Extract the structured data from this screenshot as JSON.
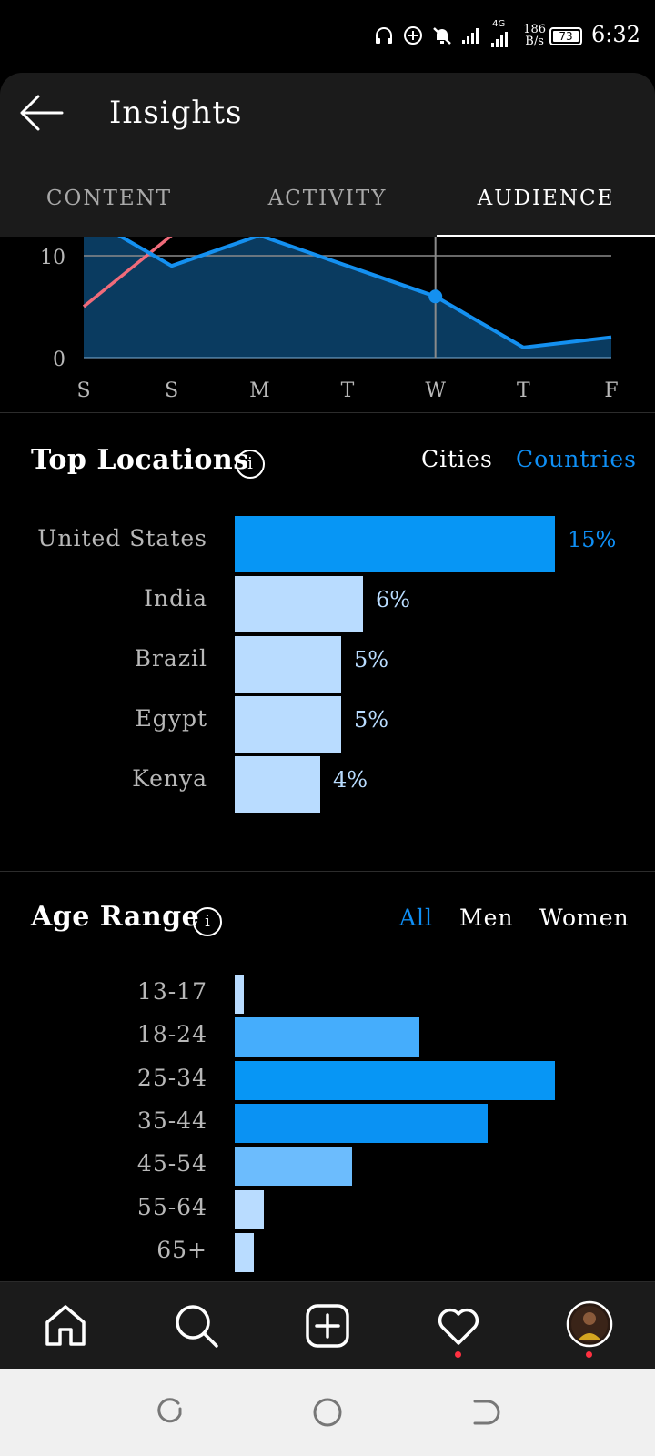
{
  "status_bar": {
    "speed_value": "186",
    "speed_unit": "B/s",
    "network": "4G",
    "battery": "73",
    "time": "6:32"
  },
  "header": {
    "title": "Insights",
    "tabs": [
      {
        "label": "CONTENT",
        "active": false
      },
      {
        "label": "ACTIVITY",
        "active": false
      },
      {
        "label": "AUDIENCE",
        "active": true
      }
    ]
  },
  "chart_data": {
    "type": "line",
    "x": [
      "S",
      "S",
      "M",
      "T",
      "W",
      "T",
      "F"
    ],
    "ylim": [
      0,
      12
    ],
    "yticks": [
      "0",
      "10"
    ],
    "grid": true,
    "series": [
      {
        "values": [
          14,
          9,
          12,
          9,
          6,
          1,
          2
        ],
        "color": "#1490f0",
        "fill": "#0a3b60"
      },
      {
        "values": [
          5,
          12
        ],
        "color": "#f06b7a"
      }
    ],
    "highlight_index": 4
  },
  "top_locations": {
    "title": "Top Locations",
    "filters": [
      {
        "label": "Cities",
        "active": false
      },
      {
        "label": "Countries",
        "active": true
      }
    ],
    "rows": [
      {
        "label": "United States",
        "value": 15,
        "display": "15%",
        "highlight": true
      },
      {
        "label": "India",
        "value": 6,
        "display": "6%",
        "highlight": false
      },
      {
        "label": "Brazil",
        "value": 5,
        "display": "5%",
        "highlight": false
      },
      {
        "label": "Egypt",
        "value": 5,
        "display": "5%",
        "highlight": false
      },
      {
        "label": "Kenya",
        "value": 4,
        "display": "4%",
        "highlight": false
      }
    ]
  },
  "age_range": {
    "title": "Age Range",
    "filters": [
      {
        "label": "All",
        "active": true
      },
      {
        "label": "Men",
        "active": false
      },
      {
        "label": "Women",
        "active": false
      }
    ],
    "rows": [
      {
        "label": "13-17",
        "value": 1.5,
        "color": "#b9dcff"
      },
      {
        "label": "18-24",
        "value": 30,
        "color": "#45adfc"
      },
      {
        "label": "25-34",
        "value": 52,
        "color": "#0796f5"
      },
      {
        "label": "35-44",
        "value": 41,
        "color": "#0a92f3"
      },
      {
        "label": "45-54",
        "value": 19,
        "color": "#6cbcfd"
      },
      {
        "label": "55-64",
        "value": 4.7,
        "color": "#b9dcff"
      },
      {
        "label": "65+",
        "value": 3.1,
        "color": "#b9dcff"
      }
    ]
  },
  "colors": {
    "accent": "#0f8ff5",
    "bar_highlight": "#0796f5",
    "bar_light": "#b9dcff",
    "notification_dot": "#ff3040"
  },
  "bottom_nav": {
    "items": [
      "home-icon",
      "search-icon",
      "add-post-icon",
      "activity-heart-icon",
      "profile-avatar"
    ]
  }
}
